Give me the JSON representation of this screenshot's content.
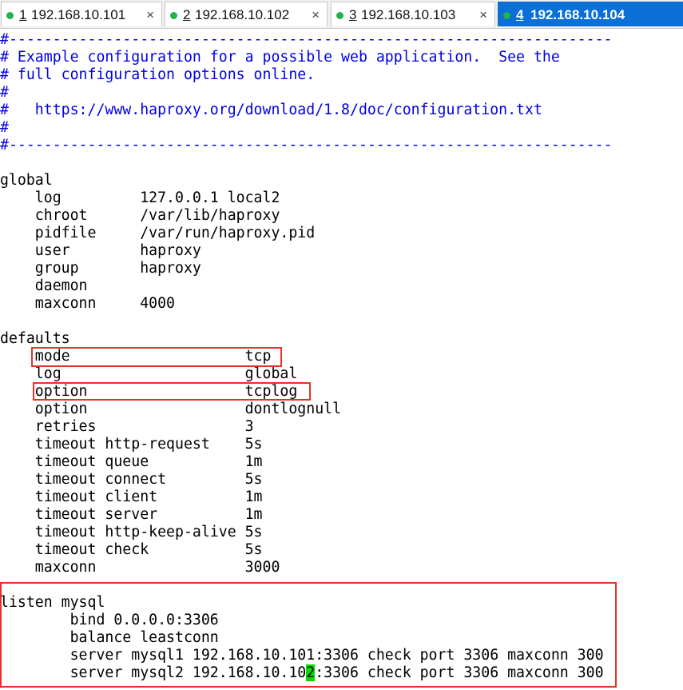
{
  "tabs": [
    {
      "num": "1",
      "host": "192.168.10.101",
      "active": false
    },
    {
      "num": "2",
      "host": "192.168.10.102",
      "active": false
    },
    {
      "num": "3",
      "host": "192.168.10.103",
      "active": false
    },
    {
      "num": "4",
      "host": "192.168.10.104",
      "active": true
    }
  ],
  "close_glyph": "×",
  "scroll_arrow": "▶",
  "terminal": {
    "header_comments": [
      "#---------------------------------------------------------------------",
      "# Example configuration for a possible web application.  See the",
      "# full configuration options online.",
      "#",
      "#   https://www.haproxy.org/download/1.8/doc/configuration.txt",
      "#",
      "#---------------------------------------------------------------------"
    ],
    "blank": " ",
    "global_section": [
      "global",
      "    log         127.0.0.1 local2",
      "    chroot      /var/lib/haproxy",
      "    pidfile     /var/run/haproxy.pid",
      "    user        haproxy",
      "    group       haproxy",
      "    daemon",
      "    maxconn     4000"
    ],
    "defaults_section": [
      "defaults",
      "    mode                    tcp",
      "    log                     global",
      "    option                  tcplog",
      "    option                  dontlognull",
      "    retries                 3",
      "    timeout http-request    5s",
      "    timeout queue           1m",
      "    timeout connect         5s",
      "    timeout client          1m",
      "    timeout server          1m",
      "    timeout http-keep-alive 5s",
      "    timeout check           5s",
      "    maxconn                 3000"
    ],
    "listen_section": [
      "listen mysql",
      "        bind 0.0.0.0:3306",
      "        balance leastconn",
      "        server mysql1 192.168.10.101:3306 check port 3306 maxconn 300"
    ],
    "last_line_before_cursor": "        server mysql2 192.168.10.10",
    "cursor_char": "2",
    "last_line_after_cursor": ":3306 check port 3306 maxconn 300"
  },
  "colors": {
    "comment": "#0000e6",
    "active_tab": "#0a6fd6",
    "status_dot": "#22b14c",
    "highlight_box": "#e8302a",
    "cursor": "#00e000"
  }
}
